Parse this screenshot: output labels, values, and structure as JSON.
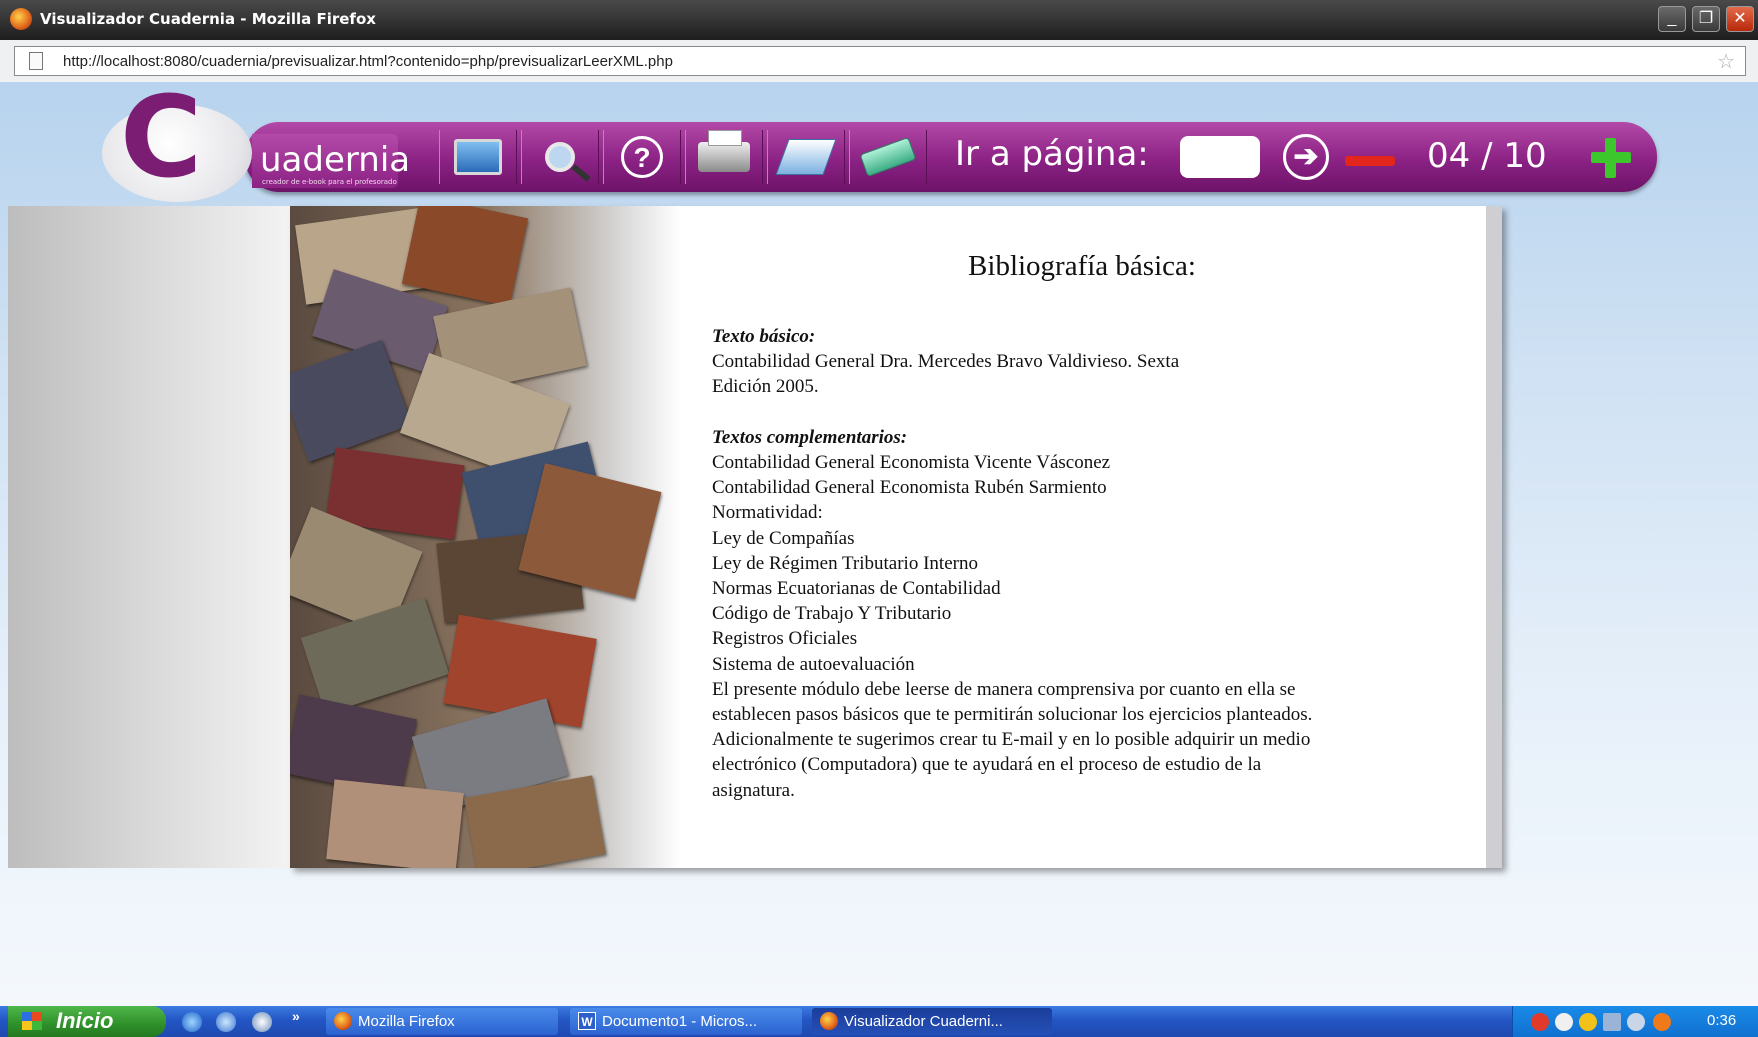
{
  "window": {
    "title": "Visualizador Cuadernia - Mozilla Firefox",
    "controls": {
      "minimize": "_",
      "maximize": "❐",
      "close": "✕"
    }
  },
  "addressbar": {
    "url": "http://localhost:8080/cuadernia/previsualizar.html?contenido=php/previsualizarLeerXML.php"
  },
  "toolbar": {
    "logo_letter": "C",
    "logo_word": "uadernia",
    "logo_tagline": "creador de e-book para el profesorado",
    "goto_label": "Ir a página:",
    "goto_value": "",
    "go_arrow": "➔",
    "page_indicator": "04 / 10",
    "help_symbol": "?",
    "icons": [
      "monitor-icon",
      "zoom-icon",
      "help-icon",
      "print-icon",
      "edit-icon",
      "eraser-icon",
      "arrow-right-icon",
      "minus-icon",
      "plus-icon"
    ]
  },
  "document": {
    "title": "Bibliografía básica:",
    "heading_basic": "Texto básico:",
    "basic_lines": [
      "Contabilidad General Dra. Mercedes Bravo Valdivieso. Sexta",
      "Edición 2005."
    ],
    "heading_complementary": "Textos complementarios:",
    "complementary_lines": [
      "Contabilidad General Economista Vicente Vásconez",
      "Contabilidad General Economista Rubén Sarmiento",
      "Normatividad:",
      "Ley de Compañías",
      "Ley de Régimen Tributario Interno",
      "Normas Ecuatorianas de Contabilidad",
      "Código de Trabajo Y Tributario",
      "Registros Oficiales",
      "Sistema de autoevaluación",
      "El presente módulo debe leerse de manera comprensiva por cuanto en ella se",
      "establecen pasos básicos que te permitirán solucionar los ejercicios planteados.",
      "Adicionalmente te sugerimos crear tu E-mail y en lo posible adquirir un medio",
      "electrónico (Computadora) que te ayudará en el proceso de estudio de la",
      "asignatura."
    ]
  },
  "taskbar": {
    "start_label": "Inicio",
    "quicklaunch_more": "»",
    "tasks": [
      {
        "label": "Mozilla Firefox",
        "active": false
      },
      {
        "label": "Documento1 - Micros...",
        "active": false
      },
      {
        "label": "Visualizador Cuaderni...",
        "active": true
      }
    ],
    "clock": "0:36"
  },
  "colors": {
    "toolbar_purple": "#8b2284",
    "taskbar_blue": "#2356c4",
    "start_green": "#2f8f2a"
  }
}
